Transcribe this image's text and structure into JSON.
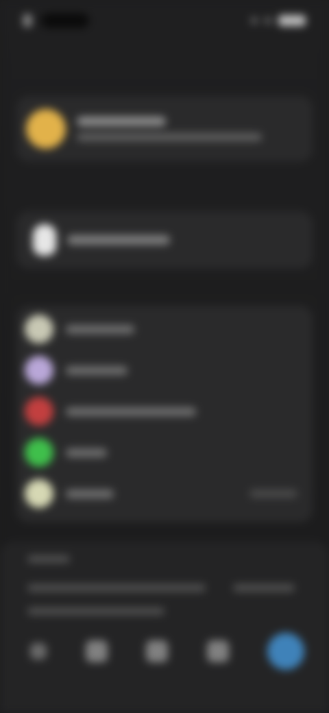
{
  "status_bar": {
    "time": "",
    "battery": ""
  },
  "header": {
    "title": ""
  },
  "profile": {
    "name": "",
    "subtitle": "",
    "avatar_color": "#e2b24a"
  },
  "single_item": {
    "label": "",
    "icon": "watch-icon",
    "icon_color": "#e6e6e6"
  },
  "list": {
    "items": [
      {
        "label": "",
        "icon": "app-icon",
        "color": "#c8c8b4",
        "trailing": ""
      },
      {
        "label": "",
        "icon": "app-icon",
        "color": "#b9a7d8",
        "trailing": ""
      },
      {
        "label": "",
        "icon": "app-icon",
        "color": "#c23f3f",
        "trailing": ""
      },
      {
        "label": "",
        "icon": "app-icon",
        "color": "#3fbf4b",
        "trailing": ""
      },
      {
        "label": "",
        "icon": "app-icon",
        "color": "#d6d8b4",
        "trailing": ""
      }
    ]
  },
  "bottom_sheet": {
    "title": "",
    "lines": [
      "",
      "",
      ""
    ]
  },
  "bottom_nav": {
    "items": [
      {
        "icon": "nav-icon-1"
      },
      {
        "icon": "nav-icon-2"
      },
      {
        "icon": "nav-icon-3"
      },
      {
        "icon": "nav-icon-4"
      },
      {
        "icon": "fab-icon",
        "color": "#3f82b9"
      }
    ]
  }
}
